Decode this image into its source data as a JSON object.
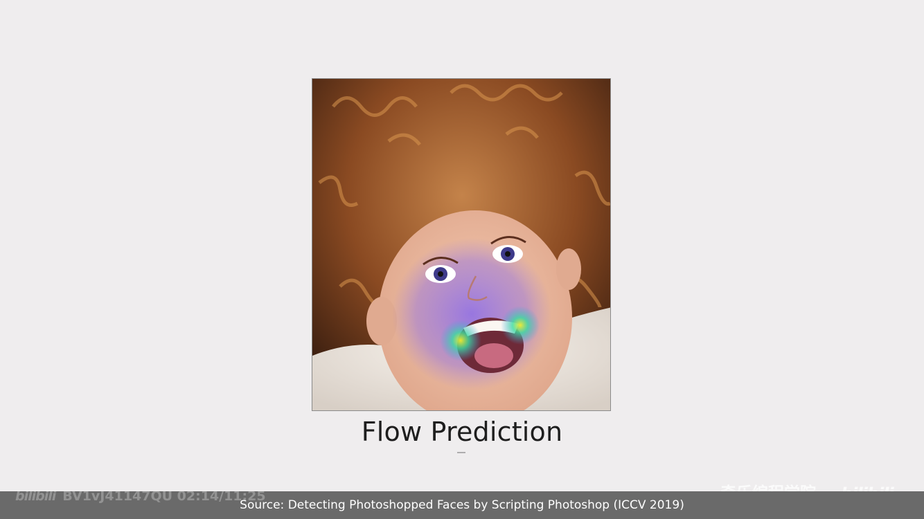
{
  "slide": {
    "caption": "Flow Prediction",
    "source": "Source: Detecting Photoshopped Faces by Scripting Photoshop (ICCV 2019)"
  },
  "watermark": {
    "left_logo": "bilibili",
    "left_text": "BV1vJ41147QU 02:14/11:25",
    "right_cn": "奇乐编程学院",
    "right_logo": "bilibili"
  },
  "colors": {
    "background": "#efedee",
    "bottom_bar": "#6a6a6a",
    "heatmap_low": "#6a3cff",
    "heatmap_mid": "#34d6a8",
    "heatmap_high": "#e8e832"
  }
}
